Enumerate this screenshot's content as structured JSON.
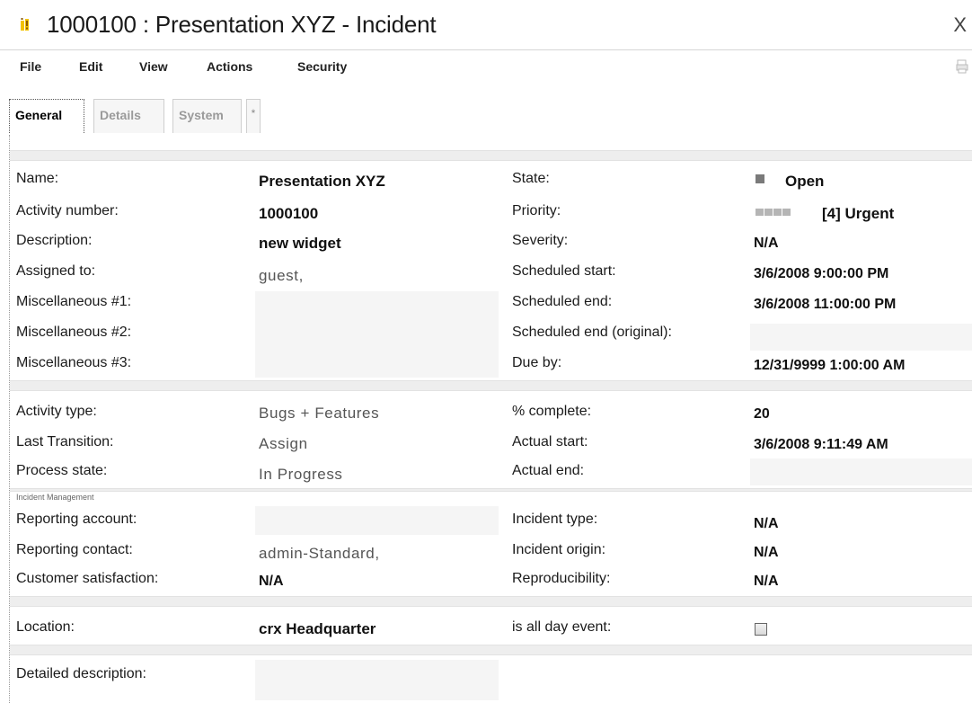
{
  "window": {
    "title": "1000100 : Presentation XYZ - Incident",
    "close_label": "X"
  },
  "menu": {
    "file": "File",
    "edit": "Edit",
    "view": "View",
    "actions": "Actions",
    "security": "Security"
  },
  "tabs": {
    "general": "General",
    "details": "Details",
    "system": "System",
    "more": "*"
  },
  "general": {
    "name_label": "Name:",
    "name_value": "Presentation XYZ",
    "activity_number_label": "Activity number:",
    "activity_number_value": "1000100",
    "description_label": "Description:",
    "description_value": "new widget",
    "assigned_to_label": "Assigned to:",
    "assigned_to_value": "guest,",
    "misc1_label": "Miscellaneous #1:",
    "misc2_label": "Miscellaneous #2:",
    "misc3_label": "Miscellaneous #3:",
    "state_label": "State:",
    "state_value": "Open",
    "priority_label": "Priority:",
    "priority_value": "[4] Urgent",
    "severity_label": "Severity:",
    "severity_value": "N/A",
    "scheduled_start_label": "Scheduled start:",
    "scheduled_start_value": "3/6/2008 9:00:00 PM",
    "scheduled_end_label": "Scheduled end:",
    "scheduled_end_value": "3/6/2008 11:00:00 PM",
    "scheduled_end_original_label": "Scheduled end (original):",
    "due_by_label": "Due by:",
    "due_by_value": "12/31/9999 1:00:00 AM"
  },
  "process": {
    "activity_type_label": "Activity type:",
    "activity_type_value": "Bugs + Features",
    "last_transition_label": "Last Transition:",
    "last_transition_value": "Assign",
    "process_state_label": "Process state:",
    "process_state_value": "In Progress",
    "percent_complete_label": "% complete:",
    "percent_complete_value": "20",
    "actual_start_label": "Actual start:",
    "actual_start_value": "3/6/2008 9:11:49 AM",
    "actual_end_label": "Actual end:"
  },
  "incident": {
    "section_title": "Incident Management",
    "reporting_account_label": "Reporting account:",
    "reporting_contact_label": "Reporting contact:",
    "reporting_contact_value": "admin-Standard,",
    "customer_satisfaction_label": "Customer satisfaction:",
    "customer_satisfaction_value": "N/A",
    "incident_type_label": "Incident type:",
    "incident_type_value": "N/A",
    "incident_origin_label": "Incident origin:",
    "incident_origin_value": "N/A",
    "reproducibility_label": "Reproducibility:",
    "reproducibility_value": "N/A"
  },
  "location": {
    "location_label": "Location:",
    "location_value": "crx Headquarter",
    "all_day_label": "is all day event:",
    "all_day_checked": false
  },
  "detailed": {
    "label": "Detailed description:"
  },
  "colors": {
    "icon_yellow": "#f2c200",
    "icon_brown": "#8a5a00",
    "separator": "#eeeeee",
    "state_square": "#7a7a7a",
    "priority_bar": "#b5b5b5"
  },
  "icons": {
    "title_icon": "incident-icon",
    "toolbar_icon": "print-icon"
  }
}
